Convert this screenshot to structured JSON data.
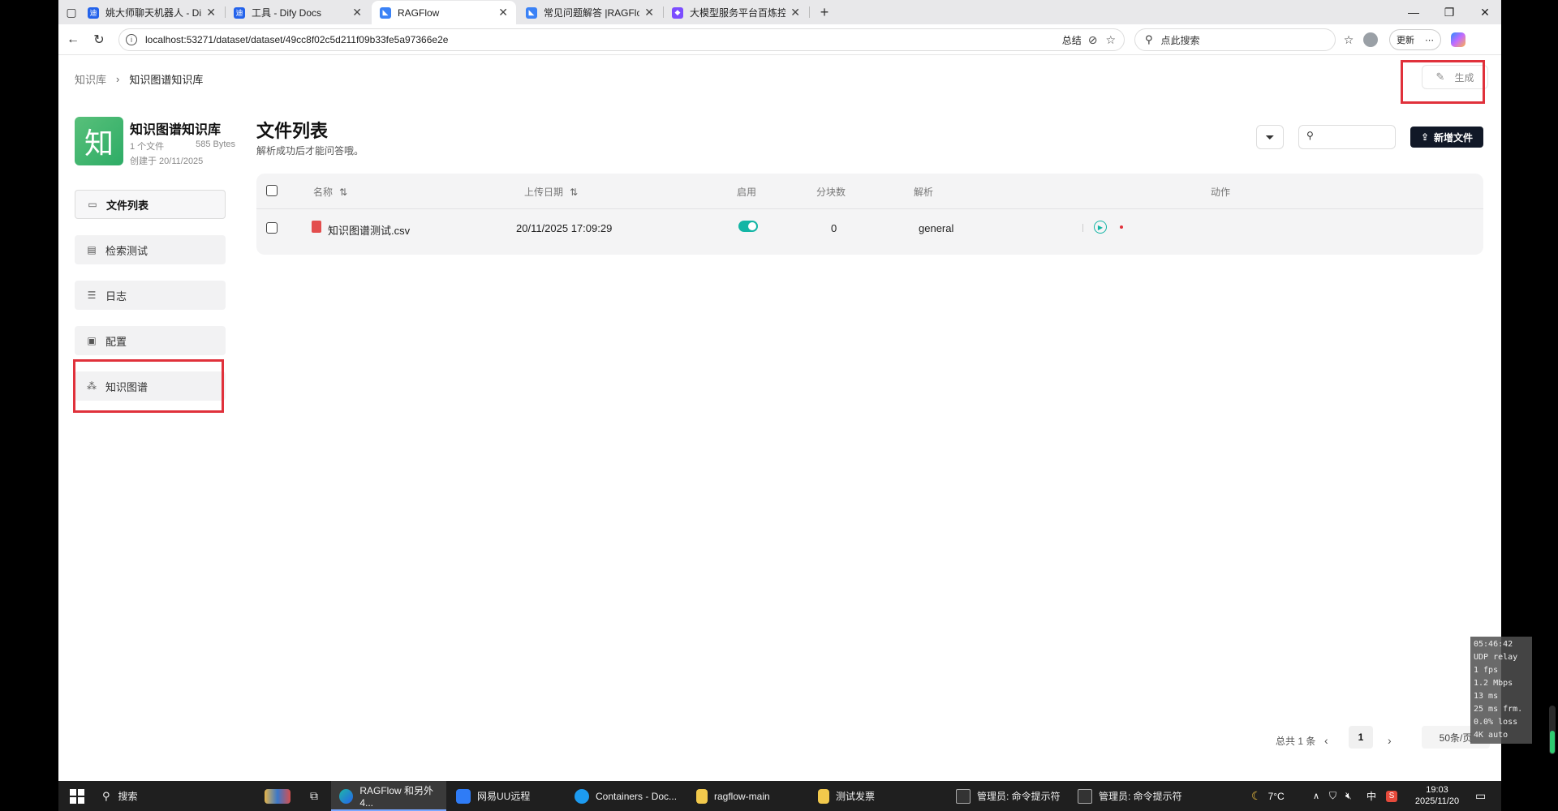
{
  "browser": {
    "tabs": [
      {
        "title": "姚大师聊天机器人 - Dify"
      },
      {
        "title": "工具 - Dify Docs"
      },
      {
        "title": "RAGFlow"
      },
      {
        "title": "常见问题解答 |RAGFlow"
      },
      {
        "title": "大模型服务平台百炼控制台"
      }
    ],
    "url": "localhost:53271/dataset/dataset/49cc8f02c5d211f09b33fe5a97366e2e",
    "summary_label": "总结",
    "search_placeholder": "点此搜索",
    "update_label": "更新"
  },
  "breadcrumb": {
    "root": "知识库",
    "current": "知识图谱知识库"
  },
  "generate_button": "生成",
  "kb": {
    "avatar_char": "知",
    "name": "知识图谱知识库",
    "file_count": "1 个文件",
    "size": "585 Bytes",
    "created": "创建于 20/11/2025"
  },
  "sidebar": {
    "items": [
      {
        "label": "文件列表",
        "icon": "folder-icon"
      },
      {
        "label": "检索测试",
        "icon": "doc-search-icon"
      },
      {
        "label": "日志",
        "icon": "list-icon"
      },
      {
        "label": "配置",
        "icon": "settings-card-icon"
      },
      {
        "label": "知识图谱",
        "icon": "graph-icon"
      }
    ]
  },
  "main": {
    "title": "文件列表",
    "subtitle": "解析成功后才能问答哦。",
    "new_file_label": "新增文件"
  },
  "table": {
    "columns": {
      "name": "名称",
      "upload_date": "上传日期",
      "enabled": "启用",
      "chunks": "分块数",
      "parse": "解析",
      "action": "动作"
    },
    "rows": [
      {
        "name": "知识图谱测试.csv",
        "upload_date": "20/11/2025 17:09:29",
        "enabled": true,
        "chunks": "0",
        "parse": "general"
      }
    ]
  },
  "pagination": {
    "total": "总共 1 条",
    "current": "1",
    "page_size": "50条/页"
  },
  "stats_overlay": "05:46:42\nUDP relay\n1 fps\n1.2 Mbps\n13 ms\n25 ms frm.\n0.0% loss\n4K auto",
  "taskbar": {
    "search": "搜索",
    "items": [
      {
        "label": "RAGFlow 和另外 4..."
      },
      {
        "label": "网易UU远程"
      },
      {
        "label": "Containers - Doc..."
      },
      {
        "label": "ragflow-main"
      },
      {
        "label": "测试发票"
      },
      {
        "label": "管理员: 命令提示符"
      },
      {
        "label": "管理员: 命令提示符"
      }
    ],
    "weather": "7°C",
    "ime": "中",
    "time": "19:03",
    "date": "2025/11/20"
  },
  "colors": {
    "accent_teal": "#13b5a5",
    "highlight_red": "#e0313b",
    "primary_dark": "#111827"
  }
}
